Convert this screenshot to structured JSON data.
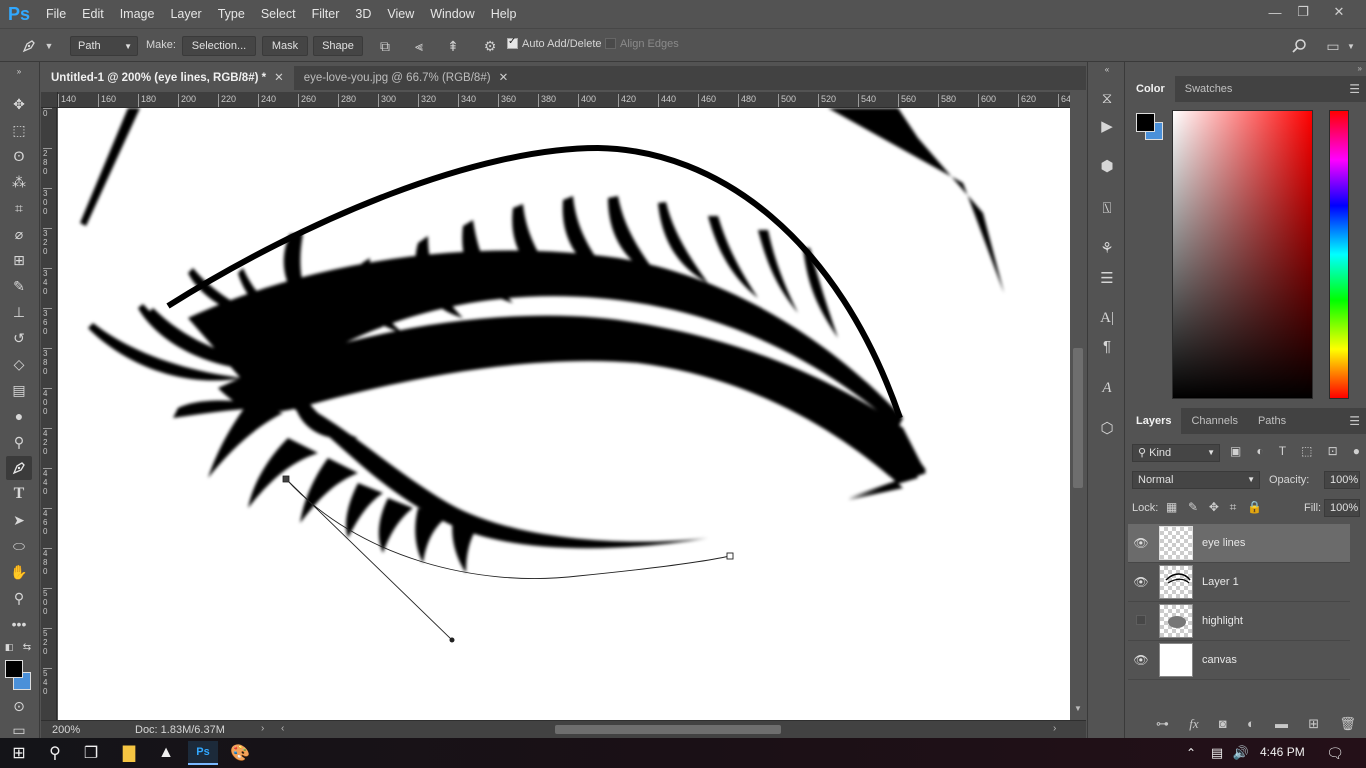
{
  "app": {
    "logo": "Ps"
  },
  "menu": [
    "File",
    "Edit",
    "Image",
    "Layer",
    "Type",
    "Select",
    "Filter",
    "3D",
    "View",
    "Window",
    "Help"
  ],
  "window_controls": {
    "minimize": "—",
    "restore": "❐",
    "close": "✕"
  },
  "options_bar": {
    "tool_mode": "Path",
    "make_label": "Make:",
    "selection_btn": "Selection...",
    "mask_btn": "Mask",
    "shape_btn": "Shape",
    "auto_add_delete": {
      "label": "Auto Add/Delete",
      "checked": true
    },
    "align_edges": {
      "label": "Align Edges",
      "checked": false
    }
  },
  "tabs": [
    {
      "label": "Untitled-1 @ 200% (eye lines, RGB/8#) *",
      "active": true
    },
    {
      "label": "eye-love-you.jpg @ 66.7% (RGB/8#)",
      "active": false
    }
  ],
  "rulers": {
    "horizontal": [
      "140",
      "160",
      "180",
      "200",
      "220",
      "240",
      "260",
      "280",
      "300",
      "320",
      "340",
      "360",
      "380",
      "400",
      "420",
      "440",
      "460",
      "480",
      "500",
      "520",
      "540",
      "560",
      "580",
      "600",
      "620",
      "64"
    ],
    "vertical": [
      "0",
      "2 8 0",
      "3 0 0",
      "3 2 0",
      "3 4 0",
      "3 6 0",
      "3 8 0",
      "4 0 0",
      "4 2 0",
      "4 4 0",
      "4 6 0",
      "4 8 0",
      "5 0 0",
      "5 2 0",
      "5 4 0"
    ]
  },
  "status": {
    "zoom": "200%",
    "doc": "Doc: 1.83M/6.37M"
  },
  "color_panel": {
    "tabs": [
      "Color",
      "Swatches"
    ],
    "foreground": "#000000",
    "background": "#4a90d9"
  },
  "layers_panel": {
    "tabs": [
      "Layers",
      "Channels",
      "Paths"
    ],
    "filter_kind": "Kind",
    "blend_mode": "Normal",
    "opacity_label": "Opacity:",
    "opacity": "100%",
    "lock_label": "Lock:",
    "fill_label": "Fill:",
    "fill": "100%",
    "layers": [
      {
        "name": "eye lines",
        "visible": true,
        "selected": true
      },
      {
        "name": "Layer 1",
        "visible": true,
        "selected": false
      },
      {
        "name": "highlight",
        "visible": false,
        "selected": false
      },
      {
        "name": "canvas",
        "visible": true,
        "selected": false
      }
    ]
  },
  "taskbar": {
    "time": "4:46 PM"
  }
}
